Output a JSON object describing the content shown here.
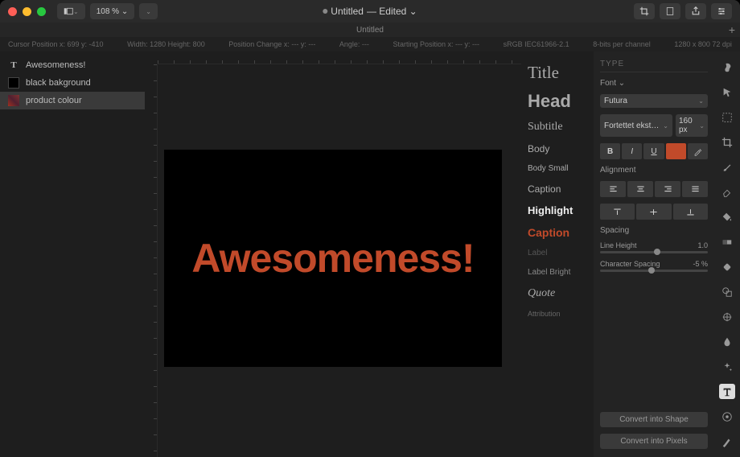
{
  "titlebar": {
    "zoom": "108 % ⌄",
    "title_prefix": "Untitled",
    "title_suffix": "— Edited ⌄"
  },
  "tabbar": {
    "tab": "Untitled"
  },
  "infobar": {
    "cursor": "Cursor Position x: 699    y: -410",
    "size": "Width: 1280    Height: 800",
    "poschange": "Position Change x: ---    y: ---",
    "angle": "Angle: ---",
    "startpos": "Starting Position x: ---    y: ---",
    "colorspace": "sRGB IEC61966-2.1",
    "bits": "8-bits per channel",
    "dims": "1280 x 800 72 dpi"
  },
  "layers": [
    {
      "name": "Awesomeness!",
      "icon": "text"
    },
    {
      "name": "black bakground",
      "icon": "black"
    },
    {
      "name": "product colour",
      "icon": "pcolor"
    }
  ],
  "canvas": {
    "text": "Awesomeness!",
    "text_color": "#c14a2a"
  },
  "text_styles": [
    {
      "label": "Title",
      "cls": "style-title"
    },
    {
      "label": "Head",
      "cls": "style-head"
    },
    {
      "label": "Subtitle",
      "cls": "style-subtitle"
    },
    {
      "label": "Body",
      "cls": "style-body"
    },
    {
      "label": "Body Small",
      "cls": "style-bodysmall"
    },
    {
      "label": "Caption",
      "cls": "style-caption"
    },
    {
      "label": "Highlight",
      "cls": "style-highlight"
    },
    {
      "label": "Caption",
      "cls": "style-caption2"
    },
    {
      "label": "Label",
      "cls": "style-label"
    },
    {
      "label": "Label Bright",
      "cls": "style-labelbright"
    },
    {
      "label": "Quote",
      "cls": "style-quote"
    },
    {
      "label": "Attribution",
      "cls": "style-attr"
    }
  ],
  "inspector": {
    "header": "TYPE",
    "font_label": "Font ⌄",
    "font_family": "Futura",
    "font_weight": "Fortettet ekstra fet",
    "font_size": "160 px",
    "bold": "B",
    "italic": "I",
    "underline": "U",
    "alignment_label": "Alignment",
    "spacing_label": "Spacing",
    "line_height_label": "Line Height",
    "line_height_value": "1.0",
    "char_spacing_label": "Character Spacing",
    "char_spacing_value": "-5 %",
    "convert_shape": "Convert into Shape",
    "convert_pixels": "Convert into Pixels"
  }
}
